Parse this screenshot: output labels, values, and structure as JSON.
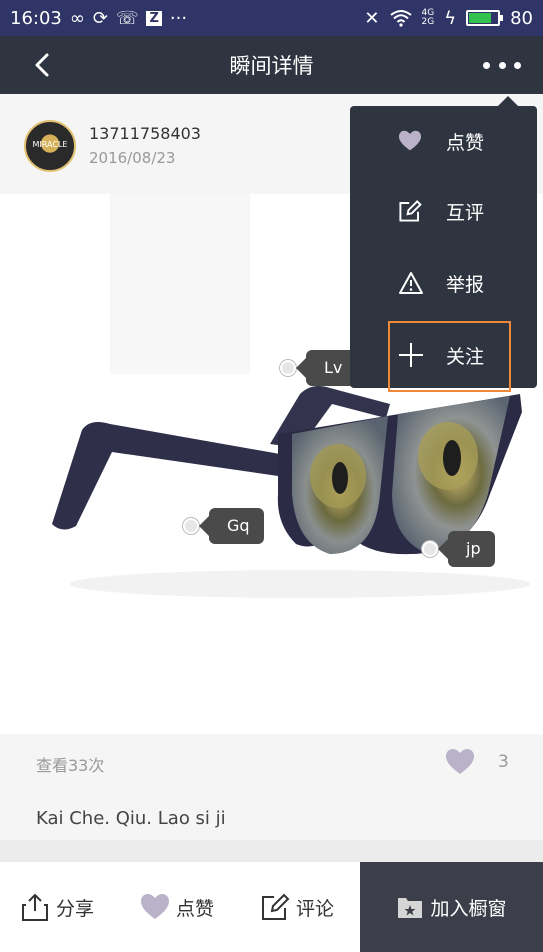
{
  "status_bar": {
    "time": "16:03",
    "left_icons": [
      "infinity-icon",
      "sync-icon",
      "missed-call-icon",
      "z-app-icon",
      "more-icon"
    ],
    "right_icons": [
      "mute-icon",
      "wifi-icon",
      "signal-icon",
      "charging-icon",
      "battery-icon"
    ],
    "signal_labels": [
      "4G",
      "2G"
    ],
    "battery_level": "80",
    "battery_fill_fraction": 0.8
  },
  "header": {
    "title": "瞬间详情"
  },
  "post": {
    "username": "13711758403",
    "date": "2016/08/23",
    "avatar_text": "MIRACLE",
    "tags": [
      {
        "label": "Lv"
      },
      {
        "label": "Gq"
      },
      {
        "label": "jp"
      }
    ],
    "views": "查看33次",
    "like_count": "3",
    "caption": "Kai Che. Qiu. Lao si ji"
  },
  "bottom_bar": {
    "share_label": "分享",
    "like_label": "点赞",
    "comment_label": "评论",
    "window_label": "加入橱窗"
  },
  "menu": {
    "items": [
      {
        "label": "点赞",
        "icon": "heart-icon"
      },
      {
        "label": "互评",
        "icon": "edit-icon"
      },
      {
        "label": "举报",
        "icon": "warning-icon"
      },
      {
        "label": "关注",
        "icon": "plus-icon"
      }
    ],
    "highlight_color": "#f08a3a"
  },
  "colors": {
    "status_bar_bg": "#2f3566",
    "title_bar_bg": "#2e3440",
    "window_button_bg": "#3c3f4a",
    "heart_color": "#b9b2c8"
  }
}
